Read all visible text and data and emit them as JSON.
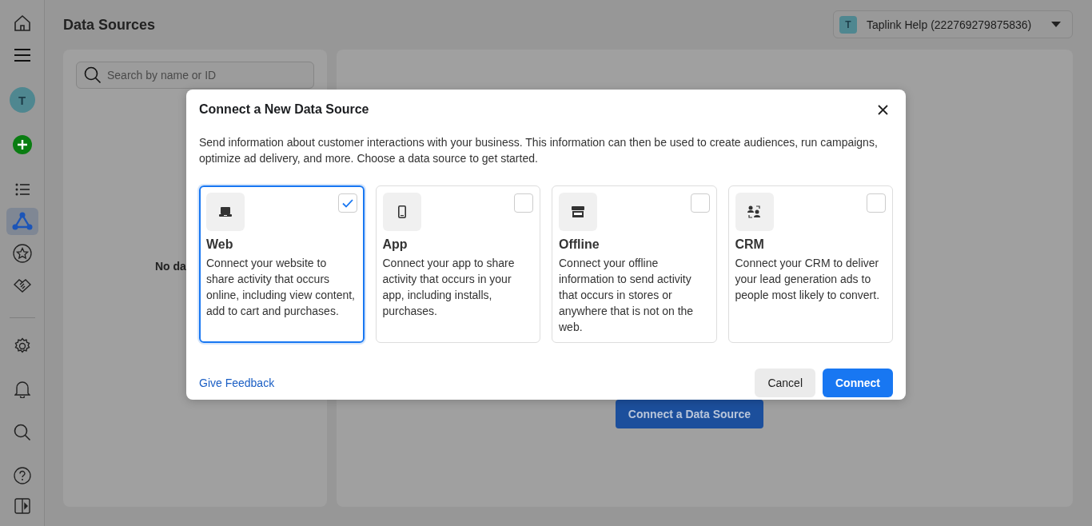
{
  "sidebar": {
    "top_items": [
      {
        "kind": "home",
        "selected": false
      },
      {
        "kind": "menu",
        "selected": false
      },
      {
        "kind": "avatar",
        "label": "T",
        "selected": false
      },
      {
        "kind": "create",
        "selected": false
      },
      {
        "kind": "list",
        "selected": false
      },
      {
        "kind": "network",
        "selected": true
      },
      {
        "kind": "star",
        "selected": false
      },
      {
        "kind": "handshake",
        "selected": false
      }
    ],
    "bottom_items": [
      {
        "kind": "settings",
        "selected": false
      },
      {
        "kind": "bell",
        "selected": false
      },
      {
        "kind": "search",
        "selected": false
      },
      {
        "kind": "help",
        "selected": false
      },
      {
        "kind": "panel",
        "selected": false
      }
    ]
  },
  "page": {
    "title": "Data Sources",
    "account": {
      "initial": "T",
      "name": "Taplink Help (222769279875836)"
    }
  },
  "left_panel": {
    "search": {
      "placeholder": "Search by name or ID"
    },
    "empty_text": "No da"
  },
  "main_panel": {
    "button": "Connect a Data Source"
  },
  "dialog": {
    "title": "Connect a New Data Source",
    "description": "Send information about customer interactions with your business. This information can then be used to create audiences, run campaigns, optimize ad delivery, and more. Choose a data source to get started.",
    "options": [
      {
        "kind": "web",
        "title": "Web",
        "description": "Connect your website to share activity that occurs online, including view content, add to cart and purchases.",
        "selected": true
      },
      {
        "kind": "app",
        "title": "App",
        "description": "Connect your app to share activity that occurs in your app, including installs, purchases.",
        "selected": false
      },
      {
        "kind": "offline",
        "title": "Offline",
        "description": "Connect your offline information to send activity that occurs in stores or anywhere that is not on the web.",
        "selected": false
      },
      {
        "kind": "crm",
        "title": "CRM",
        "description": "Connect your CRM to deliver your lead generation ads to people most likely to convert.",
        "selected": false
      }
    ],
    "feedback_link": "Give Feedback",
    "cancel_button": "Cancel",
    "connect_button": "Connect"
  }
}
